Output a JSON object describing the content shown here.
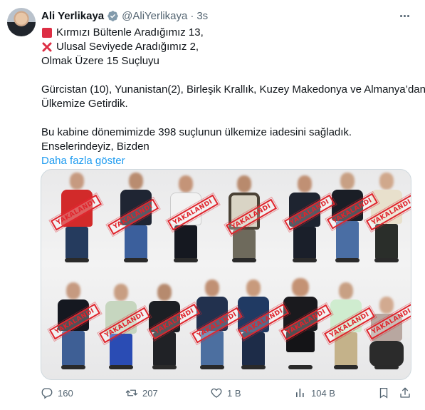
{
  "author": {
    "display_name": "Ali Yerlikaya",
    "handle": "@AliYerlikaya",
    "separator": "·",
    "time": "3s"
  },
  "tweet": {
    "lines": [
      "Kırmızı Bültenle Aradığımız 13,",
      "Ulusal Seviyede Aradığımız 2,",
      "Olmak Üzere 15 Suçluyu",
      "Gürcistan (10), Yunanistan(2), Birleşik Krallık, Kuzey Makedonya ve Almanya’dan",
      "Ülkemize Getirdik.",
      "Bu kabine dönemimizde 398 suçlunun ülkemize iadesini sağladık.",
      "Enselerindeyiz, Bizden"
    ],
    "show_more": "Daha fazla göster"
  },
  "media": {
    "stamp_text": "YAKALANDI",
    "stamp_color": "#e0242c"
  },
  "actions": {
    "replies": "160",
    "reposts": "207",
    "likes": "1 B",
    "views": "104 B"
  },
  "icons": [
    "verified-badge-icon",
    "more-icon",
    "red-square-emoji",
    "cross-mark-emoji",
    "reply-icon",
    "repost-icon",
    "like-icon",
    "views-icon",
    "bookmark-icon",
    "share-icon"
  ]
}
